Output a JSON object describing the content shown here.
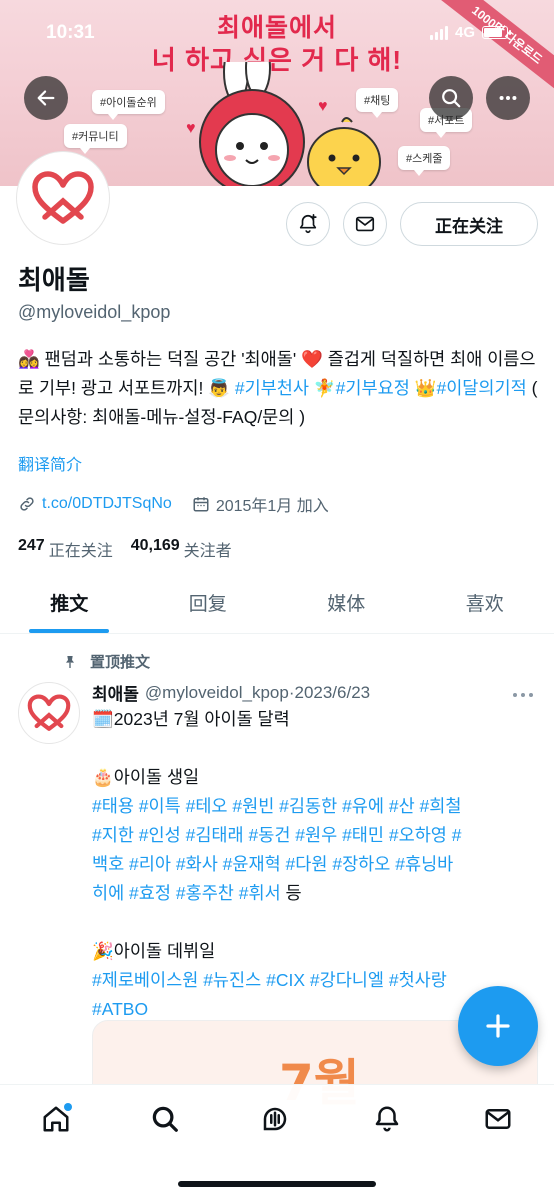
{
  "status_bar": {
    "time": "10:31",
    "network": "4G"
  },
  "banner": {
    "line1": "최애돌에서",
    "line2": "너 하고 싶은 거 다 해!",
    "ribbon": "1000만 다운로드",
    "tags": [
      "#아이돌순위",
      "#커뮤니티",
      "#채팅",
      "#서포트",
      "#스케줄"
    ]
  },
  "header": {
    "back_icon": "arrow-left-icon",
    "search_icon": "search-icon",
    "more_icon": "more-horizontal-icon"
  },
  "profile": {
    "name": "최애돌",
    "handle": "@myloveidol_kpop",
    "follow_label": "正在关注",
    "bio": {
      "emoji1": "👩‍❤️‍👩",
      "text1": " 팬덤과 소통하는 덕질 공간 '최애돌' ",
      "emoji2": "❤️",
      "text2": " 즐겁게 덕질하면 최애 이름으로 기부! 광고 서포트까지! ",
      "emoji3": "👼",
      "tag1": "#기부천사",
      "emoji4": "🧚",
      "tag2": "#기부요정",
      "emoji5": "👑",
      "tag3": "#이달의기적",
      "text3": " ( 문의사항: 최애돌-메뉴-설정-FAQ/문의 )"
    },
    "translate_label": "翻译简介",
    "link": "t.co/0DTDJTSqNo",
    "joined": "2015年1月 加入",
    "following_count": "247",
    "following_label": "正在关注",
    "followers_count": "40,169",
    "followers_label": "关注者"
  },
  "tabs": [
    {
      "label": "推文",
      "active": true
    },
    {
      "label": "回复",
      "active": false
    },
    {
      "label": "媒体",
      "active": false
    },
    {
      "label": "喜欢",
      "active": false
    }
  ],
  "pinned_tweet": {
    "pinned_label": "置顶推文",
    "name": "최애돌",
    "handle": "@myloveidol_kpop",
    "separator": "·",
    "date": "2023/6/23",
    "line1": "🗓️2023년 7월 아이돌 달력",
    "birthday_heading": "🎂아이돌 생일",
    "birthday_tags_l1": "#태용 #이특 #테오 #원빈 #김동한 #유에 #산 #희철",
    "birthday_tags_l2": "#지한 #인성 #김태래 #동건 #원우 #태민 #오하영 #",
    "birthday_tags_l3": "백호 #리아 #화사 #윤재혁 #다원 #장하오 #휴닝바",
    "birthday_tags_l4": "히에 #효정 #홍주찬 #휘서",
    "birthday_suffix": " 등",
    "debut_heading": "🎉아이돌 데뷔일",
    "debut_tags_l1": "#제로베이스원 #뉴진스 #CIX #강다니엘 #첫사랑",
    "debut_tags_l2": "#ATBO",
    "media_text": "7월"
  },
  "bottom_nav": [
    "home-icon",
    "search-icon",
    "spaces-icon",
    "notifications-icon",
    "messages-icon"
  ],
  "colors": {
    "accent": "#1d9bf0",
    "brand_red": "#e2294d",
    "text": "#0f1419",
    "muted": "#536471"
  }
}
